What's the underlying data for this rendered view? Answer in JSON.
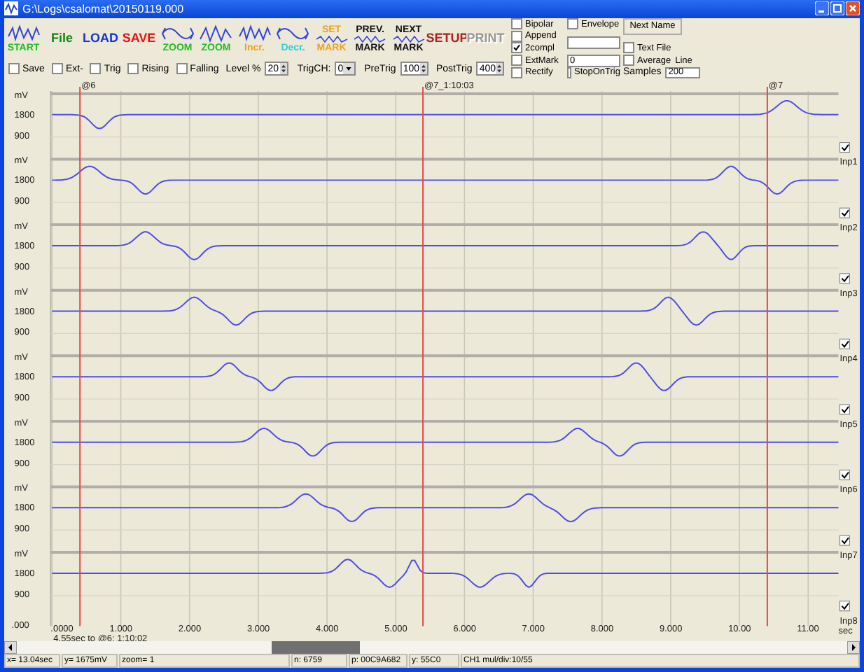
{
  "window": {
    "title": "G:\\Logs\\csalomat\\20150119.000"
  },
  "toolbar": [
    {
      "kind": "icon",
      "label": "START",
      "color": "#22bb22",
      "disabled": false
    },
    {
      "kind": "text",
      "label": "File",
      "color": "#118811",
      "disabled": false
    },
    {
      "kind": "text",
      "label": "LOAD",
      "color": "#1133dd",
      "disabled": false
    },
    {
      "kind": "text",
      "label": "SAVE",
      "color": "#ee1111",
      "disabled": false
    },
    {
      "kind": "icon",
      "label": "ZOOM",
      "color": "#22bb22",
      "disabled": false
    },
    {
      "kind": "icon",
      "label": "ZOOM",
      "color": "#22bb22",
      "disabled": false
    },
    {
      "kind": "icon",
      "label": "Incr.",
      "color": "#f0a020",
      "disabled": false
    },
    {
      "kind": "icon",
      "label": "Decr.",
      "color": "#33ccdd",
      "disabled": false
    },
    {
      "kind": "icon2",
      "top_label": "SET",
      "label": "MARK",
      "color": "#f0a020",
      "disabled": false
    },
    {
      "kind": "icon2",
      "top_label": "PREV.",
      "label": "MARK",
      "color": "#111111",
      "disabled": false
    },
    {
      "kind": "icon2",
      "top_label": "NEXT",
      "label": "MARK",
      "color": "#111111",
      "disabled": false
    },
    {
      "kind": "text",
      "label": "SETUP",
      "color": "#aa2222",
      "disabled": false
    },
    {
      "kind": "text",
      "label": "PRINT",
      "color": "#999999",
      "disabled": true
    }
  ],
  "trigger_options": [
    {
      "kind": "checkbox",
      "label": "Save",
      "checked": false
    },
    {
      "kind": "checkbox",
      "label": "Ext-",
      "checked": false
    },
    {
      "kind": "checkbox",
      "label": "Trig",
      "checked": false
    },
    {
      "kind": "checkbox",
      "label": "Rising",
      "checked": false
    },
    {
      "kind": "checkbox",
      "label": "Falling",
      "checked": false
    },
    {
      "kind": "spin",
      "label": "Level %",
      "value": "20"
    },
    {
      "kind": "select",
      "label": "TrigCH:",
      "value": "0"
    },
    {
      "kind": "spin",
      "label": "PreTrig",
      "value": "100"
    },
    {
      "kind": "spin",
      "label": "PostTrig",
      "value": "400"
    }
  ],
  "options_panel": {
    "checks": [
      {
        "label": "Bipolar",
        "checked": false
      },
      {
        "label": "Append",
        "checked": false
      },
      {
        "label": "2compl",
        "checked": true
      },
      {
        "label": "ExtMark",
        "checked": false
      },
      {
        "label": "Rectify",
        "checked": false
      }
    ],
    "envelope": {
      "label": "Envelope",
      "checked": false
    },
    "extmark_field": {
      "value": "0"
    },
    "stop_on_trig": {
      "label": "StopOnTrig",
      "checked": false
    },
    "next_name_button": "Next Name",
    "text_file": {
      "label": "Text File",
      "checked": false
    },
    "average": {
      "label": "Average",
      "checked": false
    },
    "line_label": "Line",
    "samples": {
      "label": "Samples",
      "value": "200"
    }
  },
  "plot": {
    "markers": [
      "@6",
      "@7_1:10:03",
      "@7"
    ],
    "channels": [
      {
        "unit": "mV",
        "tick_high": "1800",
        "tick_low": "900",
        "name": "Inp1",
        "checked": true
      },
      {
        "unit": "mV",
        "tick_high": "1800",
        "tick_low": "900",
        "name": "Inp2",
        "checked": true
      },
      {
        "unit": "mV",
        "tick_high": "1800",
        "tick_low": "900",
        "name": "Inp3",
        "checked": true
      },
      {
        "unit": "mV",
        "tick_high": "1800",
        "tick_low": "900",
        "name": "Inp4",
        "checked": true
      },
      {
        "unit": "mV",
        "tick_high": "1800",
        "tick_low": "900",
        "name": "Inp5",
        "checked": true
      },
      {
        "unit": "mV",
        "tick_high": "1800",
        "tick_low": "900",
        "name": "Inp6",
        "checked": true
      },
      {
        "unit": "mV",
        "tick_high": "1800",
        "tick_low": "900",
        "name": "Inp7",
        "checked": true
      },
      {
        "unit": "mV",
        "tick_high": "1800",
        "tick_low": "900",
        "name": "Inp8",
        "checked": true
      }
    ],
    "y_origin": ".000",
    "x_ticks": [
      ".0000",
      "1.000",
      "2.000",
      "3.000",
      "4.000",
      "5.000",
      "6.000",
      "7.000",
      "8.000",
      "9.000",
      "10.00",
      "11.00"
    ],
    "x_unit": "sec",
    "cursor_note": "4.55sec to @6: 1:10:02"
  },
  "status_bar": [
    "x= 13.04sec",
    "y= 1675mV",
    "zoom= 1",
    "n: 6759",
    "p: 00C9A682",
    "y: 55C0",
    "CH1 mul/div:10/55"
  ]
}
